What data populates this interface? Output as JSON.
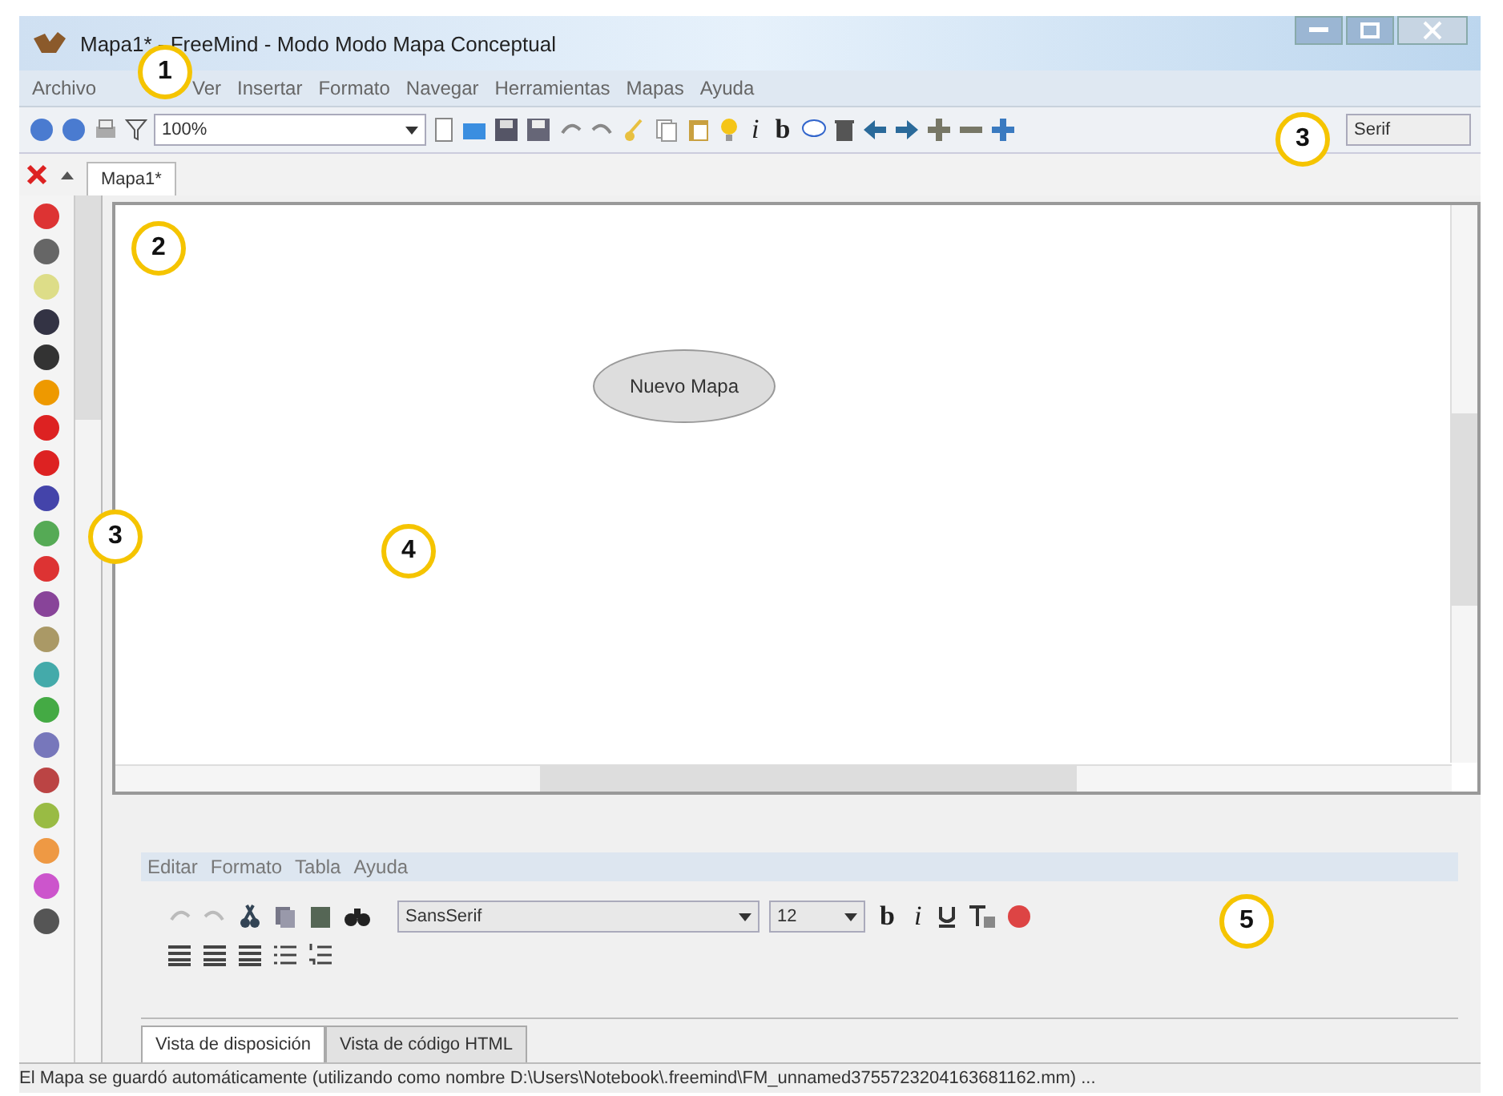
{
  "window": {
    "title": "Mapa1* - FreeMind - Modo Modo Mapa Conceptual"
  },
  "menu": [
    "Archivo",
    "Ver",
    "Insertar",
    "Formato",
    "Navegar",
    "Herramientas",
    "Mapas",
    "Ayuda"
  ],
  "toolbar": {
    "zoom": "100%",
    "italic_glyph": "i",
    "bold_glyph": "b",
    "font": "Serif"
  },
  "tabs": [
    {
      "label": "Mapa1*",
      "selected": true
    }
  ],
  "canvas": {
    "node": "Nuevo Mapa"
  },
  "editor": {
    "menu": [
      "Editar",
      "Formato",
      "Tabla",
      "Ayuda"
    ],
    "font": "SansSerif",
    "size": "12",
    "bold_glyph": "b",
    "italic_glyph": "i",
    "tabs": [
      {
        "label": "Vista de disposición",
        "selected": true
      },
      {
        "label": "Vista de código HTML",
        "selected": false
      }
    ]
  },
  "status_bar": "El Mapa se guardó automáticamente (utilizando como nombre D:\\Users\\Notebook\\.freemind\\FM_unnamed3755723204163681162.mm) ...",
  "callouts": [
    {
      "label": "1"
    },
    {
      "label": "3"
    },
    {
      "label": "2"
    },
    {
      "label": "3"
    },
    {
      "label": "4"
    },
    {
      "label": "5"
    }
  ]
}
